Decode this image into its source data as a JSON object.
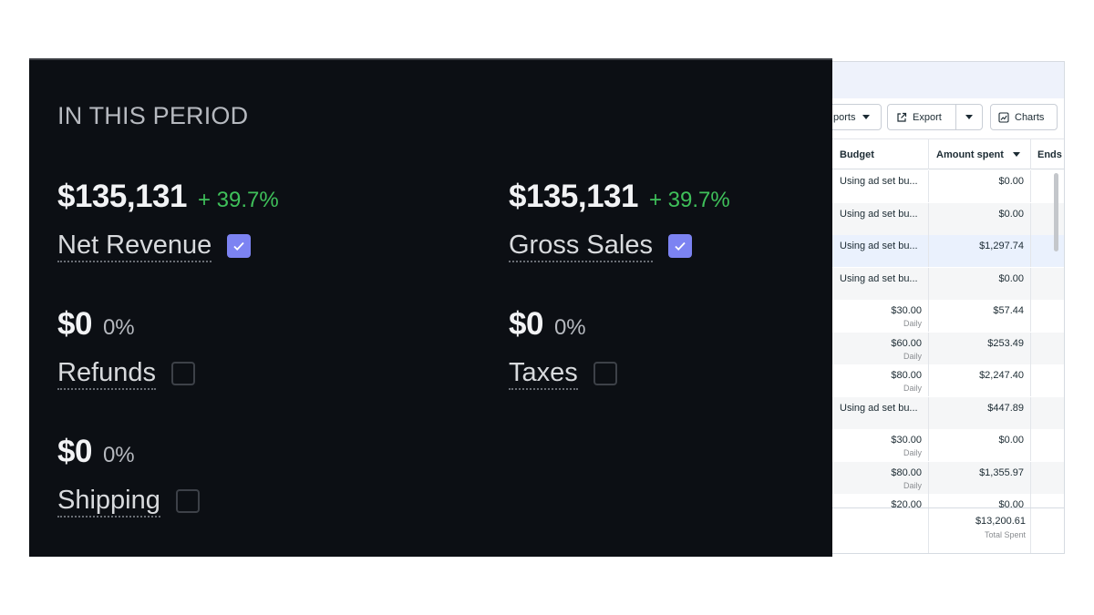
{
  "period_panel": {
    "title": "IN THIS PERIOD",
    "metrics": [
      {
        "value": "$135,131",
        "change": "+ 39.7%",
        "label": "Net Revenue",
        "checked": true
      },
      {
        "value": "$135,131",
        "change": "+ 39.7%",
        "label": "Gross Sales",
        "checked": true
      },
      {
        "value": "$0",
        "change": "0%",
        "label": "Refunds",
        "checked": false
      },
      {
        "value": "$0",
        "change": "0%",
        "label": "Taxes",
        "checked": false
      },
      {
        "value": "$0",
        "change": "0%",
        "label": "Shipping",
        "checked": false
      }
    ],
    "colors": {
      "background": "#0c0f14",
      "positive": "#3fc05a",
      "checkbox_on": "#7c83f2"
    }
  },
  "ads_table": {
    "toolbar": {
      "reports_label": "ports",
      "export_label": "Export",
      "charts_label": "Charts"
    },
    "columns": {
      "budget": "Budget",
      "amount_spent": "Amount spent",
      "ends": "Ends"
    },
    "rows": [
      {
        "budget": "Using ad set bu...",
        "budget_sub": "",
        "amount": "$0.00"
      },
      {
        "budget": "Using ad set bu...",
        "budget_sub": "",
        "amount": "$0.00"
      },
      {
        "budget": "Using ad set bu...",
        "budget_sub": "",
        "amount": "$1,297.74"
      },
      {
        "budget": "Using ad set bu...",
        "budget_sub": "",
        "amount": "$0.00"
      },
      {
        "budget": "$30.00",
        "budget_sub": "Daily",
        "amount": "$57.44"
      },
      {
        "budget": "$60.00",
        "budget_sub": "Daily",
        "amount": "$253.49"
      },
      {
        "budget": "$80.00",
        "budget_sub": "Daily",
        "amount": "$2,247.40"
      },
      {
        "budget": "Using ad set bu...",
        "budget_sub": "",
        "amount": "$447.89"
      },
      {
        "budget": "$30.00",
        "budget_sub": "Daily",
        "amount": "$0.00"
      },
      {
        "budget": "$80.00",
        "budget_sub": "Daily",
        "amount": "$1,355.97"
      },
      {
        "budget": "$20.00",
        "budget_sub": "",
        "amount": "$0.00"
      }
    ],
    "footer": {
      "total": "$13,200.61",
      "label": "Total Spent"
    }
  }
}
